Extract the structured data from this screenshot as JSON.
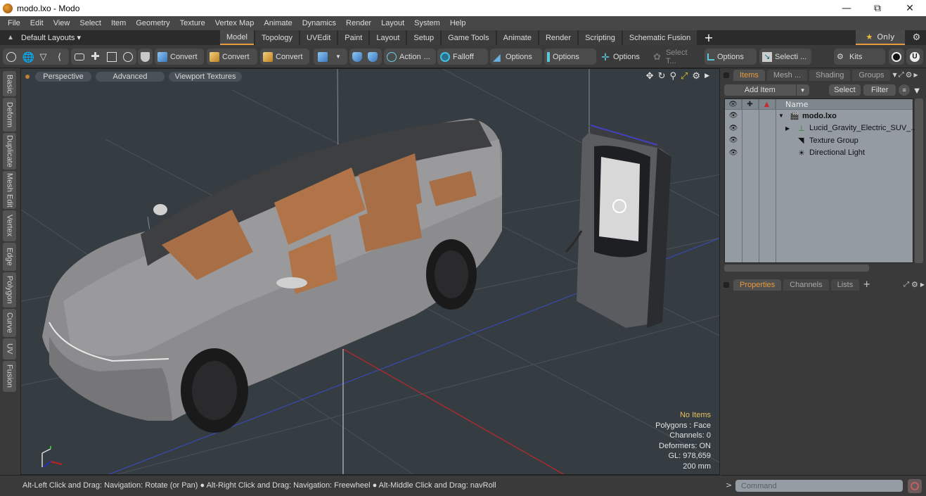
{
  "window": {
    "title": "modo.lxo - Modo",
    "controls": [
      "minimize",
      "restore",
      "close"
    ]
  },
  "menubar": {
    "items": [
      "File",
      "Edit",
      "View",
      "Select",
      "Item",
      "Geometry",
      "Texture",
      "Vertex Map",
      "Animate",
      "Dynamics",
      "Render",
      "Layout",
      "System",
      "Help"
    ]
  },
  "layoutbar": {
    "layouts_label": "Default Layouts ▾",
    "tabs": [
      {
        "label": "Model",
        "active": true
      },
      {
        "label": "Topology"
      },
      {
        "label": "UVEdit"
      },
      {
        "label": "Paint"
      },
      {
        "label": "Layout"
      },
      {
        "label": "Setup"
      },
      {
        "label": "Game Tools"
      },
      {
        "label": "Animate"
      },
      {
        "label": "Render"
      },
      {
        "label": "Scripting"
      },
      {
        "label": "Schematic Fusion"
      }
    ],
    "add_tab": "+",
    "only_label": "Only"
  },
  "toolbar": {
    "select_modes": [
      "vertices-icon",
      "edges-globe-icon",
      "polygons-pen-icon",
      "items-icon"
    ],
    "view_modes": [
      "component-icon",
      "uv-cross-icon",
      "frame-icon",
      "circle-icon"
    ],
    "convert1": "Convert",
    "convert2": "Convert",
    "convert3": "Convert",
    "action": "Action",
    "action_more": "...",
    "falloff": "Falloff",
    "options1": "Options",
    "options2": "Options",
    "options3": "Options",
    "select_t": "Select T...",
    "options4": "Options",
    "selecti": "Selecti ...",
    "kits": "Kits"
  },
  "left_tabs": [
    "Basic",
    "Deform",
    "Duplicate",
    "Mesh Edit",
    "Vertex",
    "Edge",
    "Polygon",
    "Curve",
    "UV",
    "Fusion"
  ],
  "viewport": {
    "view": "Perspective",
    "shading": "Advanced",
    "textures": "Viewport Textures",
    "info": {
      "selection": "No Items",
      "polygons": "Polygons : Face",
      "channels": "Channels: 0",
      "deformers": "Deformers: ON",
      "gl": "GL: 978,659",
      "unit": "200 mm"
    }
  },
  "status": {
    "hint": "Alt-Left Click and Drag: Navigation: Rotate (or Pan) ● Alt-Right Click and Drag: Navigation: Freewheel ● Alt-Middle Click and Drag: navRoll"
  },
  "items_panel": {
    "tabs": [
      {
        "label": "Items",
        "active": true
      },
      {
        "label": "Mesh ..."
      },
      {
        "label": "Shading"
      },
      {
        "label": "Groups"
      }
    ],
    "add_item": "Add Item",
    "select": "Select",
    "filter": "Filter",
    "name_header": "Name",
    "tree": [
      {
        "name": "modo.lxo",
        "level": 0,
        "expanded": true,
        "bold": true,
        "icon": "scene-clapper-icon"
      },
      {
        "name": "Lucid_Gravity_Electric_SUV_...",
        "level": 1,
        "collapsed": true,
        "icon": "locator-axes-icon"
      },
      {
        "name": "Texture Group",
        "level": 1,
        "icon": "texture-group-icon"
      },
      {
        "name": "Directional Light",
        "level": 1,
        "icon": "light-icon"
      }
    ]
  },
  "properties_panel": {
    "tabs": [
      {
        "label": "Properties",
        "active": true
      },
      {
        "label": "Channels"
      },
      {
        "label": "Lists"
      }
    ],
    "add_tab": "+"
  },
  "command": {
    "prompt": ">",
    "placeholder": "Command"
  },
  "colors": {
    "accent": "#e89a3c",
    "viewport_bg": "#353c42",
    "tree_bg": "#949ba3",
    "info_warn": "#e8c060"
  }
}
